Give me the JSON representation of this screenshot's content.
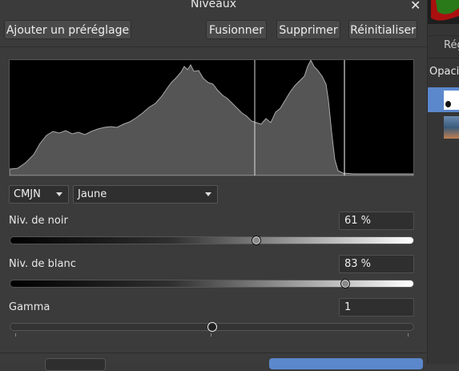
{
  "dialog": {
    "title": "Niveaux"
  },
  "toolbar": {
    "preset_label": "Ajouter un préréglage",
    "merge_label": "Fusionner",
    "delete_label": "Supprimer",
    "reset_label": "Réinitialiser"
  },
  "channel": {
    "model": "CMJN",
    "channel": "Jaune"
  },
  "black_level": {
    "label": "Niv. de noir",
    "value_text": "61 %",
    "value": 0.61
  },
  "white_level": {
    "label": "Niv. de blanc",
    "value_text": "83 %",
    "value": 0.83
  },
  "gamma": {
    "label": "Gamma",
    "value_text": "1",
    "position": 0.5
  },
  "side_panel": {
    "tab_label": "Rég",
    "opacity_label": "Opaciti"
  },
  "colors": {
    "accent": "#5b88cc",
    "background": "#3b3b3b",
    "histogram_fill": "#555555"
  }
}
